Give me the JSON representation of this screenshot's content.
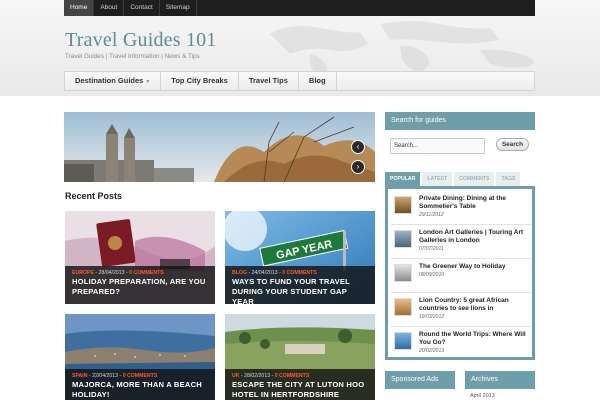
{
  "topbar": {
    "items": [
      {
        "label": "Home"
      },
      {
        "label": "About"
      },
      {
        "label": "Contact"
      },
      {
        "label": "Sitemap"
      }
    ]
  },
  "site": {
    "title": "Travel Guides 101",
    "tagline": "Travel Guides | Travel Information | News & Tips"
  },
  "nav": {
    "items": [
      {
        "label": "Destination Guides"
      },
      {
        "label": "Top City Breaks"
      },
      {
        "label": "Travel Tips"
      },
      {
        "label": "Blog"
      }
    ],
    "dropdown_icon": "caret-down-icon"
  },
  "slider": {
    "prev_icon": "chevron-left-icon",
    "next_icon": "chevron-right-icon"
  },
  "recent": {
    "heading": "Recent Posts",
    "posts": [
      {
        "category": "EUROPE",
        "date": "28/04/2013",
        "comments": "0 COMMENTS",
        "title": "HOLIDAY PREPARATION, ARE YOU PREPARED?"
      },
      {
        "category": "BLOG",
        "date": "24/04/2013",
        "comments": "0 COMMENTS",
        "title": "WAYS TO FUND YOUR TRAVEL DURING YOUR STUDENT GAP YEAR"
      },
      {
        "category": "SPAIN",
        "date": "22/04/2013",
        "comments": "0 COMMENTS",
        "title": "MAJORCA, MORE THAN A BEACH HOLIDAY!"
      },
      {
        "category": "UK",
        "date": "28/02/2013",
        "comments": "0 COMMENTS",
        "title": "ESCAPE THE CITY AT LUTON HOO HOTEL IN HERTFORDSHIRE"
      }
    ],
    "image_texts": {
      "gap_year_sign": "GAP YEAR"
    }
  },
  "search": {
    "heading": "Search for guides",
    "input_value": "Search...",
    "button_label": "Search"
  },
  "tabs": {
    "items": [
      {
        "label": "POPULAR",
        "active": true
      },
      {
        "label": "LATEST",
        "active": false
      },
      {
        "label": "COMMENTS",
        "active": false
      },
      {
        "label": "TAGS",
        "active": false
      }
    ],
    "popular": [
      {
        "title": "Private Dining: Dining at the Sommelier's Table",
        "date": "29/11/2012"
      },
      {
        "title": "London Art Galleries | Touring Art Galleries in London",
        "date": "07/07/2011"
      },
      {
        "title": "The Greener Way to Holiday",
        "date": "08/09/2010"
      },
      {
        "title": "Lion Country: 5 great African countries to see lions in",
        "date": "19/03/2012"
      },
      {
        "title": "Round the World Trips: Where Will You Go?",
        "date": "20/02/2013"
      }
    ]
  },
  "widgets": {
    "sponsored": "Sponsored Ads",
    "archives": "Archives",
    "archive_first": "April 2013"
  },
  "colors": {
    "accent": "#6d9ea9",
    "title": "#5e8c9a",
    "meta_highlight": "#ff5a2a",
    "topbar": "#1e1e1e"
  }
}
